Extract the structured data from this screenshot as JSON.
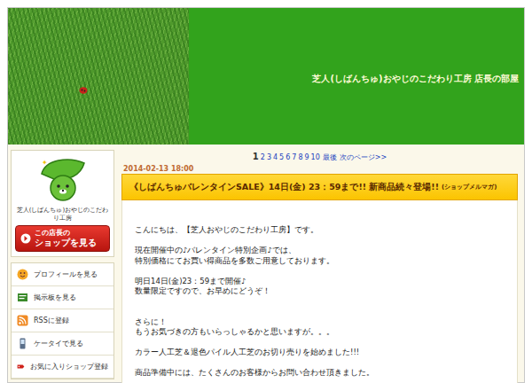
{
  "header": {
    "title": "芝人(しばんちゅ)おやじのこだわり工房 店長の部屋"
  },
  "sidebar": {
    "shop_name": "芝人(しばんちゅ)おやじのこだわり工房",
    "shop_button": [
      "この店長の",
      "ショップを見る"
    ],
    "menu": [
      {
        "label": "プロフィールを見る",
        "kind": "profile"
      },
      {
        "label": "掲示板を見る",
        "kind": "board"
      },
      {
        "label": "RSSに登録",
        "kind": "rss"
      },
      {
        "label": "ケータイで見る",
        "kind": "mobile"
      },
      {
        "label": "お気に入りショップ登録",
        "kind": "favorite"
      }
    ]
  },
  "pagination": {
    "pages": [
      {
        "label": "1",
        "selected": true
      },
      {
        "label": "2",
        "selected": false
      },
      {
        "label": "3",
        "selected": false
      },
      {
        "label": "4",
        "selected": false
      },
      {
        "label": "5",
        "selected": false
      },
      {
        "label": "6",
        "selected": false
      },
      {
        "label": "7",
        "selected": false
      },
      {
        "label": "8",
        "selected": false
      },
      {
        "label": "9",
        "selected": false
      },
      {
        "label": "10",
        "selected": false
      }
    ],
    "last": "最後",
    "next": "次のページ>>"
  },
  "post": {
    "date": "2014-02-13 18:00",
    "title": "《しばんちゅバレンタインSALE》14日(金) 23：59まで!! 新商品続々登場!!",
    "tag": "(ショップメルマガ)",
    "lines": [
      "こんにちは、【芝人おやじのこだわり工房】です。",
      "",
      "現在開催中の♪バレンタイン特別企画♪では、",
      "特別価格にてお買い得商品を多数ご用意しております。",
      "",
      "明日14日(金)23：59まで開催♪",
      "数量限定ですので、お早めにどうぞ！",
      "",
      "",
      "さらに！",
      "もうお気づきの方もいらっしゃるかと思いますが。。。",
      "",
      "カラー人工芝＆退色パイル人工芝のお切り売りを始めました!!!",
      "",
      "商品準備中には、たくさんのお客様からお問い合わせ頂きました。"
    ]
  }
}
